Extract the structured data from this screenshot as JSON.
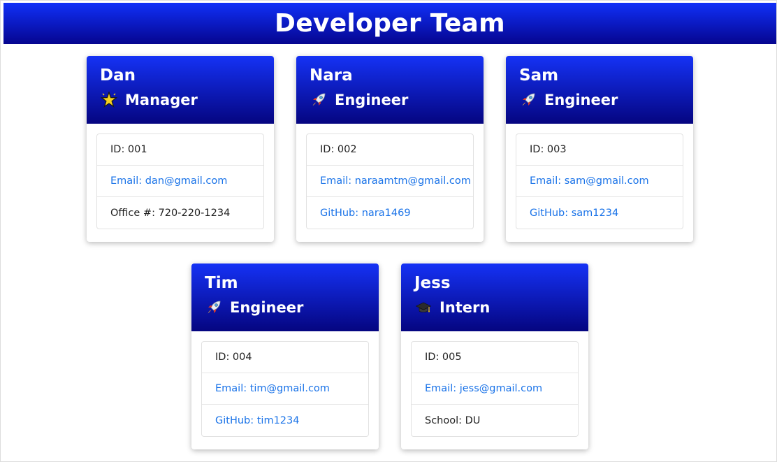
{
  "page": {
    "title": "Developer Team"
  },
  "employees": [
    {
      "name": "Dan",
      "role": "Manager",
      "role_icon": "star-icon",
      "id_text": "ID: 001",
      "email_text": "Email: dan@gmail.com",
      "extra_text": "Office #: 720-220-1234"
    },
    {
      "name": "Nara",
      "role": "Engineer",
      "role_icon": "rocket-icon",
      "id_text": "ID: 002",
      "email_text": "Email: naraamtm@gmail.com",
      "extra_text": "GitHub: nara1469"
    },
    {
      "name": "Sam",
      "role": "Engineer",
      "role_icon": "rocket-icon",
      "id_text": "ID: 003",
      "email_text": "Email: sam@gmail.com",
      "extra_text": "GitHub: sam1234"
    },
    {
      "name": "Tim",
      "role": "Engineer",
      "role_icon": "rocket-icon",
      "id_text": "ID: 004",
      "email_text": "Email: tim@gmail.com",
      "extra_text": "GitHub: tim1234"
    },
    {
      "name": "Jess",
      "role": "Intern",
      "role_icon": "graduation-cap-icon",
      "id_text": "ID: 005",
      "email_text": "Email: jess@gmail.com",
      "extra_text": "School: DU"
    }
  ],
  "colors": {
    "header_gradient_top": "#1030f8",
    "header_gradient_bottom": "#06058f",
    "link": "#1a73e8"
  }
}
